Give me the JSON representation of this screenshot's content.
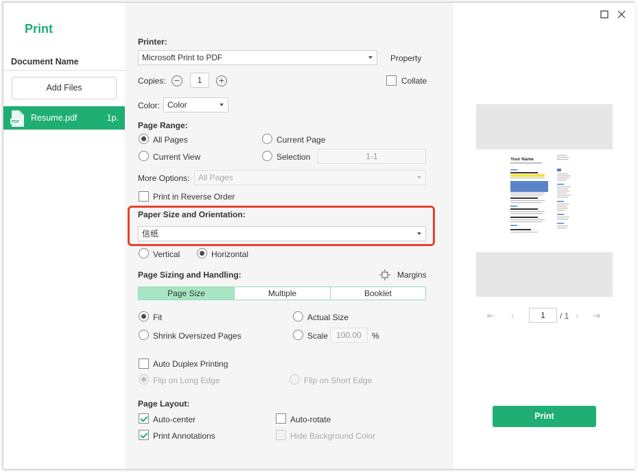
{
  "app": {
    "title": "Print"
  },
  "sidebar": {
    "document_name_label": "Document Name",
    "add_files_label": "Add Files",
    "files": [
      {
        "name": "Resume.pdf",
        "pages": "1p.",
        "icon": "pdf-file-icon",
        "icon_text": "PDF"
      }
    ]
  },
  "printer": {
    "label": "Printer:",
    "selected": "Microsoft Print to PDF",
    "property_label": "Property"
  },
  "copies": {
    "label": "Copies:",
    "value": "1",
    "collate_label": "Collate",
    "collate_checked": false
  },
  "color": {
    "label": "Color:",
    "selected": "Color"
  },
  "page_range": {
    "label": "Page Range:",
    "options": [
      "All Pages",
      "Current Page",
      "Current View",
      "Selection"
    ],
    "selected": "All Pages",
    "selection_value": "1-1"
  },
  "more_options": {
    "label": "More Options:",
    "selected": "All Pages"
  },
  "reverse_order": {
    "label": "Print in Reverse Order",
    "checked": false
  },
  "paper": {
    "label": "Paper Size and Orientation:",
    "selected": "信纸",
    "orientation_options": [
      "Vertical",
      "Horizontal"
    ],
    "orientation_selected": "Horizontal"
  },
  "sizing": {
    "label": "Page Sizing and Handling:",
    "margins_label": "Margins",
    "tabs": [
      "Page Size",
      "Multiple",
      "Booklet"
    ],
    "active_tab": "Page Size",
    "options": [
      "Fit",
      "Actual Size",
      "Shrink Oversized Pages",
      "Scale"
    ],
    "selected": "Fit",
    "scale_value": "100.00",
    "scale_unit": "%"
  },
  "duplex": {
    "label": "Auto Duplex Printing",
    "checked": false,
    "flip_long": "Flip on Long Edge",
    "flip_short": "Flip on Short Edge"
  },
  "layout": {
    "label": "Page Layout:",
    "auto_center": "Auto-center",
    "auto_rotate": "Auto-rotate",
    "print_annotations": "Print Annotations",
    "hide_background": "Hide Background Color"
  },
  "preview": {
    "resume_name": "Your Name",
    "current_page": "1",
    "total_pages": "/ 1"
  },
  "print_button_label": "Print",
  "colors": {
    "accent": "#1fae73",
    "highlight_box": "#e8402c",
    "tab_active": "#a8e6c3"
  }
}
